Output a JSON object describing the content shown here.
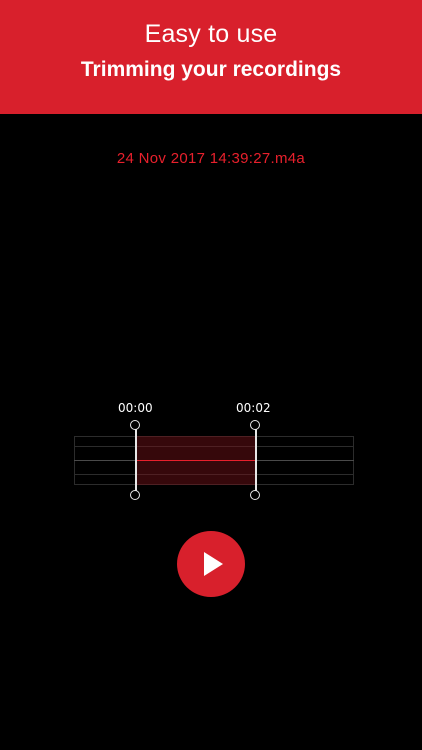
{
  "banner": {
    "line1": "Easy to use",
    "line2": "Trimming your recordings",
    "background_color": "#d8202c"
  },
  "recording": {
    "filename": "24 Nov 2017 14:39:27.m4a",
    "filename_color": "#e8202c"
  },
  "trim": {
    "start_time": "00:00",
    "end_time": "00:02"
  },
  "controls": {
    "play_icon": "play-icon"
  }
}
